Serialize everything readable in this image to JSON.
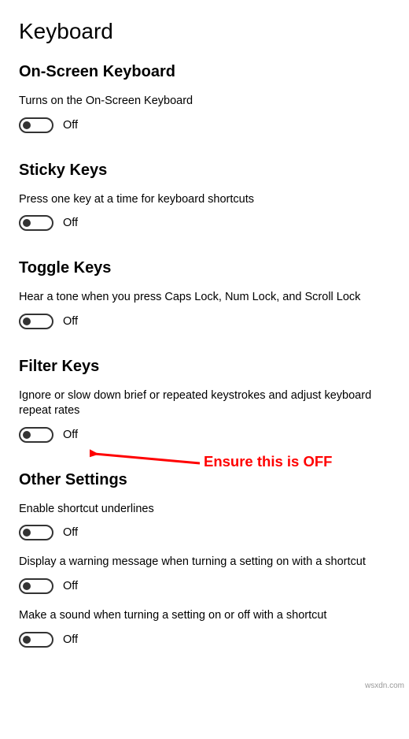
{
  "page_title": "Keyboard",
  "sections": {
    "onscreen": {
      "title": "On-Screen Keyboard",
      "desc": "Turns on the On-Screen Keyboard",
      "state": "Off"
    },
    "sticky": {
      "title": "Sticky Keys",
      "desc": "Press one key at a time for keyboard shortcuts",
      "state": "Off"
    },
    "toggle": {
      "title": "Toggle Keys",
      "desc": "Hear a tone when you press Caps Lock, Num Lock, and Scroll Lock",
      "state": "Off"
    },
    "filter": {
      "title": "Filter Keys",
      "desc": "Ignore or slow down brief or repeated keystrokes and adjust keyboard repeat rates",
      "state": "Off"
    },
    "other": {
      "title": "Other Settings",
      "shortcut_underlines": {
        "desc": "Enable shortcut underlines",
        "state": "Off"
      },
      "warning": {
        "desc": "Display a warning message when turning a setting on with a shortcut",
        "state": "Off"
      },
      "sound": {
        "desc": "Make a sound when turning a setting on or off with a shortcut",
        "state": "Off"
      }
    }
  },
  "annotation_text": "Ensure this is OFF",
  "watermark": "wsxdn.com"
}
